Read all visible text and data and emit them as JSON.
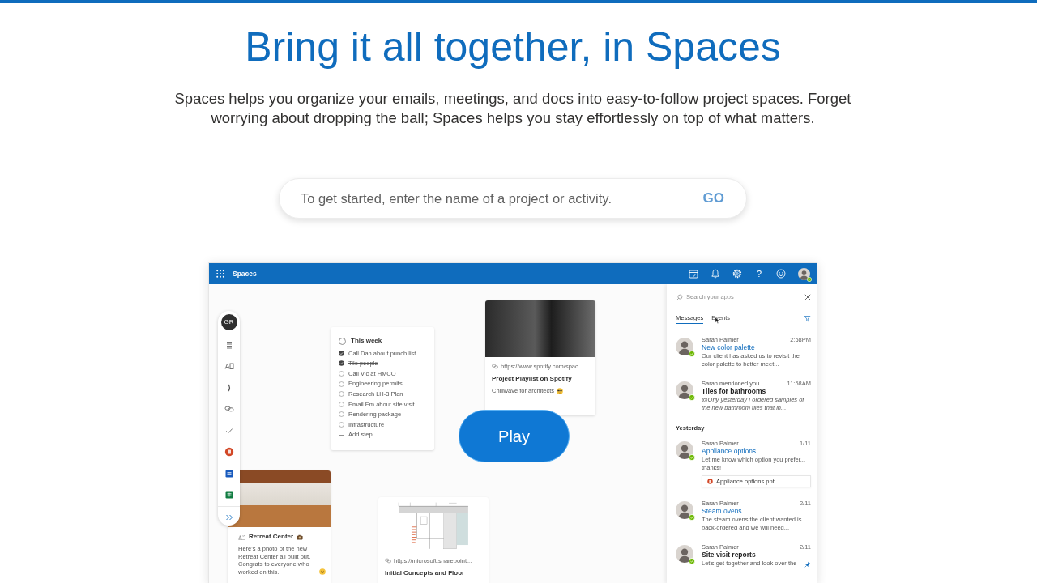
{
  "banner": {
    "heading": "Bring it all together, in Spaces",
    "description": "Spaces helps you organize your emails, meetings, and docs into easy-to-follow project spaces. Forget worrying about dropping the ball; Spaces helps you stay effortlessly on top of what matters."
  },
  "search": {
    "placeholder": "To get started, enter the name of a project or activity.",
    "go_button": {
      "label": "GO",
      "disabled": true
    }
  },
  "app": {
    "title": "Spaces",
    "help_label": "?",
    "account": {
      "online": true
    },
    "sidebar": {
      "initials": "GR"
    },
    "checklist": {
      "title": "This week",
      "items": [
        {
          "kind": "task",
          "label": "Call Dan about punch list",
          "checked": true,
          "struck": false
        },
        {
          "kind": "task",
          "label": "Tile people",
          "checked": true,
          "struck": true
        },
        {
          "kind": "task",
          "label": "Call Vic at HMCO",
          "checked": false,
          "struck": false
        },
        {
          "kind": "task",
          "label": "Engineering permits",
          "checked": false,
          "struck": false
        },
        {
          "kind": "task",
          "label": "Research LH-3 Plan",
          "checked": false,
          "struck": false
        },
        {
          "kind": "task",
          "label": "Email Em about site visit",
          "checked": false,
          "struck": false
        },
        {
          "kind": "task",
          "label": "Rendering package",
          "checked": false,
          "struck": false
        },
        {
          "kind": "task",
          "label": "Infrastructure",
          "checked": false,
          "struck": false
        },
        {
          "kind": "add",
          "label": "Add step"
        }
      ]
    },
    "playlist_card": {
      "url": "https://www.spotify.com/spac",
      "title": "Project Playlist on Spotify",
      "description": "Chillwave for architects"
    },
    "play_button": {
      "label": "Play"
    },
    "retreat_card": {
      "title": "Retreat Center",
      "description": "Here's a photo of the new Retreat Center all built out. Congrats to everyone who worked on this."
    },
    "floorplan_card": {
      "url": "https://microsoft.sharepoint...",
      "title": "Initial Concepts and Floor"
    },
    "panel": {
      "search_placeholder": "Search your apps",
      "tabs": [
        {
          "label": "Messages",
          "selected": true
        },
        {
          "label": "Events",
          "selected": false
        }
      ],
      "sections": [
        {
          "messages": [
            {
              "kind": "message",
              "sender": "Sarah Palmer",
              "time": "2:58PM",
              "title": "New color palette",
              "highlighted": true,
              "preview": "Our client has asked us to revisit the color palette to better meet...",
              "online": true,
              "pinned": false
            },
            {
              "kind": "mention",
              "sender": "Sarah mentioned you",
              "time": "11:58AM",
              "title": "Tiles for bathrooms",
              "highlighted": false,
              "preview": "@Orly yesterday I ordered samples of the new bathroom tiles that in...",
              "online": true,
              "pinned": false
            }
          ]
        },
        {
          "heading": "Yesterday",
          "messages": [
            {
              "kind": "message",
              "sender": "Sarah Palmer",
              "time": "1/11",
              "title": "Appliance options",
              "highlighted": true,
              "preview": "Let me know which option you prefer... thanks!",
              "attachment": "Appliance options.ppt",
              "online": true,
              "pinned": false
            },
            {
              "kind": "message",
              "sender": "Sarah Palmer",
              "time": "2/11",
              "title": "Steam ovens",
              "highlighted": true,
              "preview": "The steam ovens the client wanted is back-ordered and we will need...",
              "online": true,
              "pinned": false
            },
            {
              "kind": "message",
              "sender": "Sarah Palmer",
              "time": "2/11",
              "title": "Site visit reports",
              "highlighted": false,
              "preview": "Let's get together and look over the",
              "online": true,
              "pinned": true
            }
          ]
        }
      ]
    }
  }
}
